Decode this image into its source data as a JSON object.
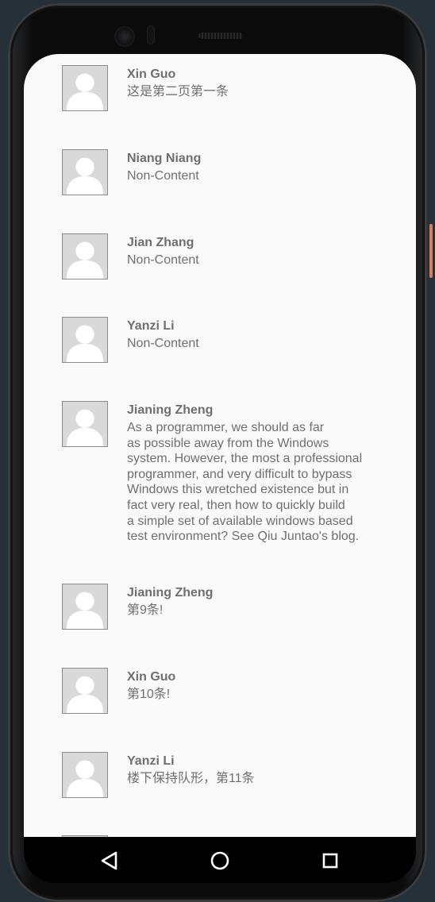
{
  "feed": {
    "items": [
      {
        "avatar_icon": "default-user-avatar-icon",
        "name": "Xin Guo",
        "content_lines": [
          "这是第二页第一条"
        ]
      },
      {
        "avatar_icon": "default-user-avatar-icon",
        "name": "Niang Niang",
        "content_lines": [
          "Non-Content"
        ]
      },
      {
        "avatar_icon": "default-user-avatar-icon",
        "name": "Jian Zhang",
        "content_lines": [
          "Non-Content"
        ]
      },
      {
        "avatar_icon": "default-user-avatar-icon",
        "name": "Yanzi Li",
        "content_lines": [
          "Non-Content"
        ]
      },
      {
        "avatar_icon": "default-user-avatar-icon",
        "name": "Jianing Zheng",
        "content_lines": [
          "As a programmer, we should as far",
          "as possible away from the Windows",
          "system. However, the most a professional",
          "programmer, and very difficult to bypass",
          "Windows this wretched existence but in",
          "fact very real, then how to quickly build",
          "a simple set of available windows based",
          "test environment? See Qiu Juntao's blog."
        ]
      },
      {
        "avatar_icon": "default-user-avatar-icon",
        "name": "Jianing Zheng",
        "content_lines": [
          "第9条!"
        ]
      },
      {
        "avatar_icon": "default-user-avatar-icon",
        "name": "Xin Guo",
        "content_lines": [
          "第10条!"
        ]
      },
      {
        "avatar_icon": "default-user-avatar-icon",
        "name": "Yanzi Li",
        "content_lines": [
          "楼下保持队形，第11条"
        ]
      }
    ]
  },
  "navigation_bar": {
    "back_icon": "back-triangle-icon",
    "home_icon": "home-circle-icon",
    "recents_icon": "recents-square-icon"
  }
}
